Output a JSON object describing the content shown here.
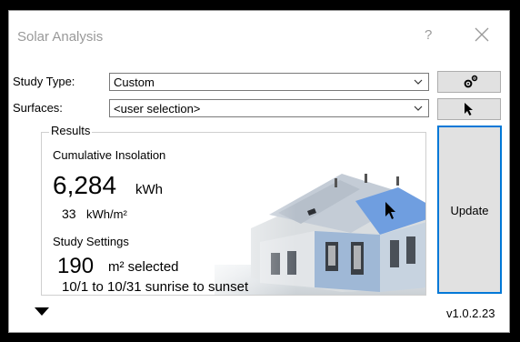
{
  "window": {
    "title": "Solar Analysis",
    "help_label": "?"
  },
  "form": {
    "study_type_label": "Study Type:",
    "study_type_value": "Custom",
    "surfaces_label": "Surfaces:",
    "surfaces_value": "<user selection>"
  },
  "results": {
    "legend": "Results",
    "cumulative_label": "Cumulative Insolation",
    "total_value": "6,284",
    "total_unit": "kWh",
    "per_area_value": "33",
    "per_area_unit": "kWh/m²",
    "settings_label": "Study Settings",
    "area_value": "190",
    "area_unit": "m² selected",
    "period": "10/1 to 10/31 sunrise to sunset"
  },
  "buttons": {
    "update_label": "Update",
    "settings_icon": "gears-icon",
    "select_icon": "cursor-arrow-icon"
  },
  "footer": {
    "version": "v1.0.2.23",
    "expander_icon": "triangle-down-icon"
  },
  "colors": {
    "accent": "#0078d7",
    "button_face": "#e1e1e1",
    "title_text": "#999999"
  }
}
